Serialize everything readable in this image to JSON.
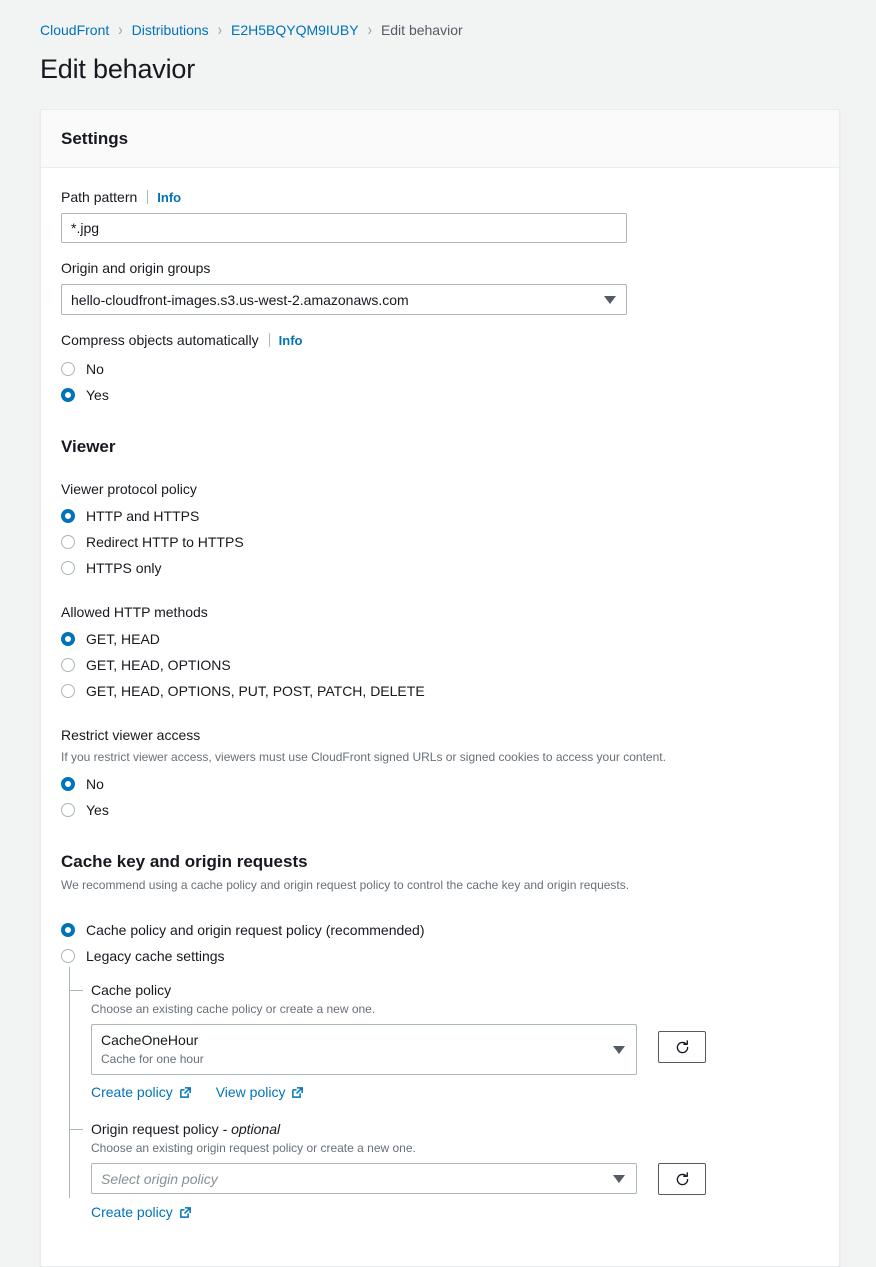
{
  "breadcrumb": {
    "items": [
      {
        "label": "CloudFront",
        "current": false
      },
      {
        "label": "Distributions",
        "current": false
      },
      {
        "label": "E2H5BQYQM9IUBY",
        "current": false
      },
      {
        "label": "Edit behavior",
        "current": true
      }
    ],
    "separator": "›"
  },
  "page": {
    "title": "Edit behavior"
  },
  "colors": {
    "link": "#0073bb",
    "accent": "#0073bb",
    "page_bg": "#f2f3f3",
    "border": "#aab7b8",
    "muted_text": "#687078"
  },
  "settings_card": {
    "header_title": "Settings",
    "path_pattern": {
      "label": "Path pattern",
      "info_label": "Info",
      "value": "*.jpg"
    },
    "origin": {
      "label": "Origin and origin groups",
      "value": "hello-cloudfront-images.s3.us-west-2.amazonaws.com"
    },
    "compress": {
      "label": "Compress objects automatically",
      "info_label": "Info",
      "options": [
        {
          "label": "No",
          "checked": false
        },
        {
          "label": "Yes",
          "checked": true
        }
      ]
    },
    "viewer": {
      "heading": "Viewer",
      "protocol_policy": {
        "label": "Viewer protocol policy",
        "options": [
          {
            "label": "HTTP and HTTPS",
            "checked": true
          },
          {
            "label": "Redirect HTTP to HTTPS",
            "checked": false
          },
          {
            "label": "HTTPS only",
            "checked": false
          }
        ]
      },
      "allowed_methods": {
        "label": "Allowed HTTP methods",
        "options": [
          {
            "label": "GET, HEAD",
            "checked": true
          },
          {
            "label": "GET, HEAD, OPTIONS",
            "checked": false
          },
          {
            "label": "GET, HEAD, OPTIONS, PUT, POST, PATCH, DELETE",
            "checked": false
          }
        ]
      },
      "restrict_viewer_access": {
        "label": "Restrict viewer access",
        "description": "If you restrict viewer access, viewers must use CloudFront signed URLs or signed cookies to access your content.",
        "options": [
          {
            "label": "No",
            "checked": true
          },
          {
            "label": "Yes",
            "checked": false
          }
        ]
      }
    },
    "cache_key": {
      "heading": "Cache key and origin requests",
      "description": "We recommend using a cache policy and origin request policy to control the cache key and origin requests.",
      "options": [
        {
          "label": "Cache policy and origin request policy (recommended)",
          "checked": true
        },
        {
          "label": "Legacy cache settings",
          "checked": false
        }
      ],
      "cache_policy": {
        "title": "Cache policy",
        "description": "Choose an existing cache policy or create a new one.",
        "selected_name": "CacheOneHour",
        "selected_description": "Cache for one hour",
        "links": [
          {
            "label": "Create policy"
          },
          {
            "label": "View policy"
          }
        ],
        "refresh_label": "refresh-icon"
      },
      "origin_request_policy": {
        "title": "Origin request policy",
        "optional_suffix": "- optional",
        "description": "Choose an existing origin request policy or create a new one.",
        "placeholder": "Select origin policy",
        "links": [
          {
            "label": "Create policy"
          }
        ],
        "refresh_label": "refresh-icon"
      }
    }
  }
}
